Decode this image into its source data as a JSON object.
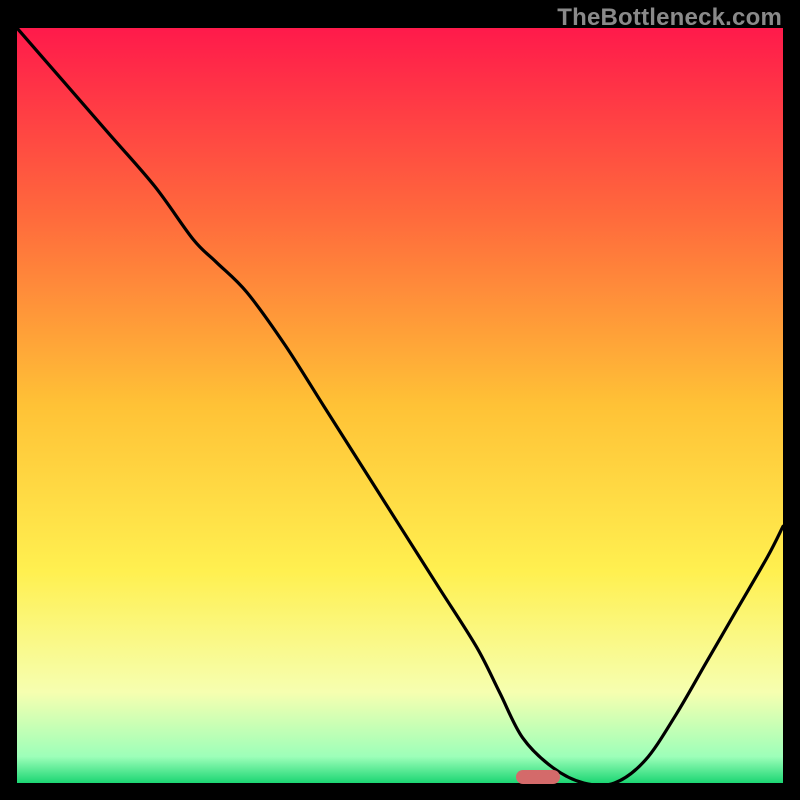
{
  "watermark": "TheBottleneck.com",
  "marker": {
    "color": "#d46a6a",
    "x_pct": 68,
    "y_pct": 99.2
  },
  "chart_data": {
    "type": "line",
    "title": "",
    "xlabel": "",
    "ylabel": "",
    "xlim": [
      0,
      100
    ],
    "ylim": [
      0,
      100
    ],
    "grid": false,
    "background_gradient": [
      {
        "pos": 0.0,
        "color": "#ff1a4b"
      },
      {
        "pos": 0.25,
        "color": "#ff6a3c"
      },
      {
        "pos": 0.5,
        "color": "#ffc236"
      },
      {
        "pos": 0.72,
        "color": "#fff050"
      },
      {
        "pos": 0.88,
        "color": "#f6ffb0"
      },
      {
        "pos": 0.965,
        "color": "#9dffb9"
      },
      {
        "pos": 1.0,
        "color": "#1cd673"
      }
    ],
    "series": [
      {
        "name": "bottleneck-curve",
        "color": "#000000",
        "x": [
          0,
          6,
          12,
          18,
          23,
          26,
          30,
          35,
          40,
          45,
          50,
          55,
          60,
          63,
          66,
          70,
          74,
          78,
          82,
          86,
          90,
          94,
          98,
          100
        ],
        "y": [
          100,
          93,
          86,
          79,
          72,
          69,
          65,
          58,
          50,
          42,
          34,
          26,
          18,
          12,
          6,
          2,
          0,
          0,
          3,
          9,
          16,
          23,
          30,
          34
        ]
      }
    ],
    "annotations": [
      {
        "type": "pill",
        "x": 68,
        "y": 0.8,
        "color": "#d46a6a",
        "meaning": "optimal-range-marker"
      }
    ]
  }
}
